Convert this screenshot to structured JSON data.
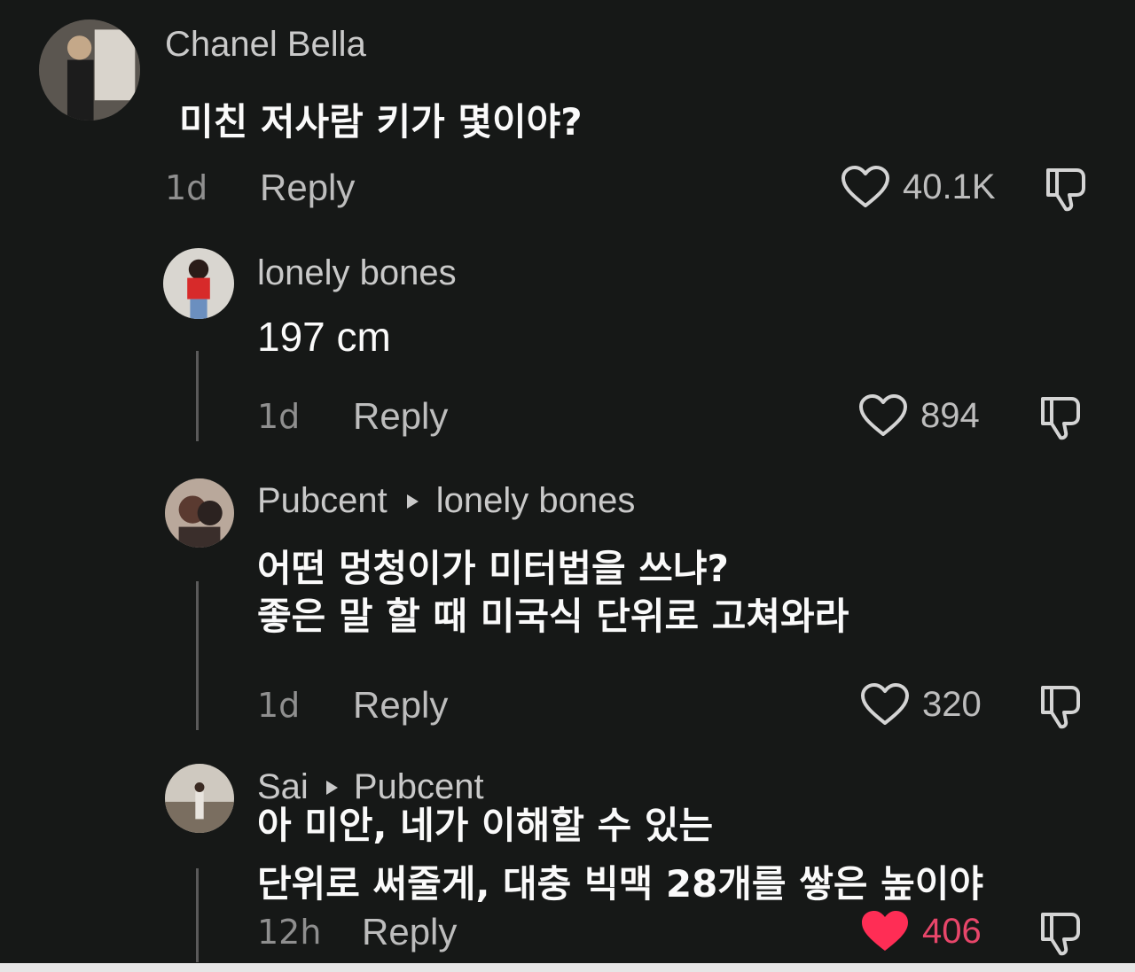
{
  "comments": [
    {
      "username": "Chanel Bella",
      "reply_to": "",
      "text_lines": [
        "미친 저사람 키가 몇이야?"
      ],
      "age": "1d",
      "reply_label": "Reply",
      "likes": "40.1K",
      "liked": false
    },
    {
      "username": "lonely bones",
      "reply_to": "",
      "text_lines": [
        "197 cm"
      ],
      "age": "1d",
      "reply_label": "Reply",
      "likes": "894",
      "liked": false
    },
    {
      "username": "Pubcent",
      "reply_to": "lonely bones",
      "text_lines": [
        "어떤 멍청이가 미터법을 쓰냐?",
        "좋은 말 할 때 미국식 단위로 고쳐와라"
      ],
      "age": "1d",
      "reply_label": "Reply",
      "likes": "320",
      "liked": false
    },
    {
      "username": "Sai",
      "reply_to": "Pubcent",
      "text_lines": [
        "아 미안, 네가 이해할 수 있는",
        "단위로 써줄게, 대충 빅맥 28개를 쌓은 높이야"
      ],
      "age": "12h",
      "reply_label": "Reply",
      "likes": "406",
      "liked": true
    }
  ],
  "colors": {
    "background": "#161817",
    "like_active": "#ff2d55",
    "text_secondary": "#bdbdbd"
  },
  "icons": [
    "heart-icon",
    "heart-filled-icon",
    "dislike-icon",
    "reply-arrow-icon"
  ]
}
